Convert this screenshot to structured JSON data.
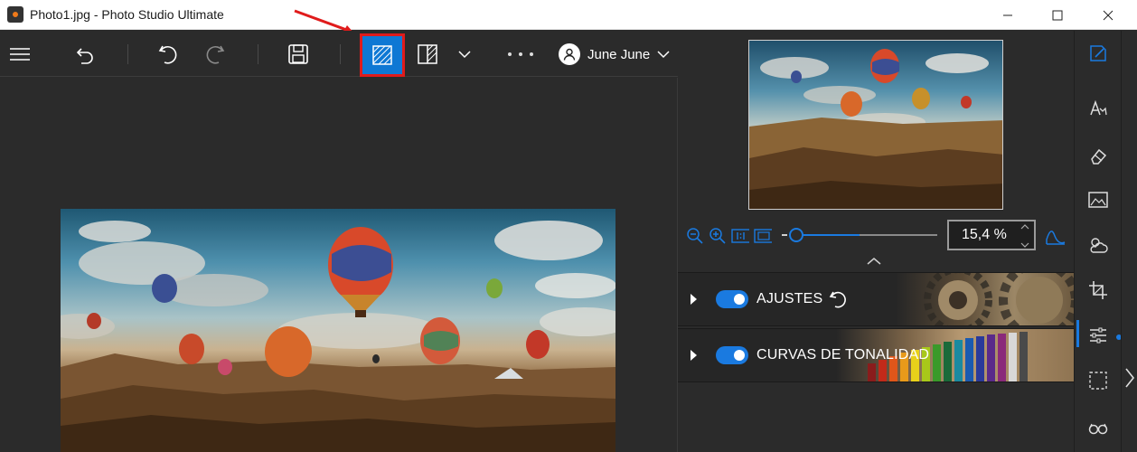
{
  "window": {
    "title": "Photo1.jpg - Photo Studio Ultimate"
  },
  "toolbar": {
    "user_name": "June June"
  },
  "zoom": {
    "value": "15,4 %",
    "slider_fraction": 0.0
  },
  "panels": [
    {
      "label": "AJUSTES",
      "enabled": true
    },
    {
      "label": "CURVAS DE TONALIDAD",
      "enabled": true
    }
  ],
  "colors": {
    "accent": "#0e78d4",
    "highlight_border": "#e01b1b",
    "toggle_on": "#1a7ae0"
  },
  "icons": {
    "menu": "hamburger-icon",
    "back": "back-icon",
    "undo": "undo-icon",
    "redo": "redo-icon",
    "save": "save-icon",
    "split_view": "split-view-icon",
    "before_after": "before-after-icon",
    "more": "more-icon",
    "user": "user-icon",
    "sidebar": [
      "edit-icon",
      "text-style-icon",
      "eraser-icon",
      "frame-icon",
      "weather-icon",
      "crop-icon",
      "adjust-icon",
      "selection-icon",
      "glasses-icon"
    ]
  }
}
